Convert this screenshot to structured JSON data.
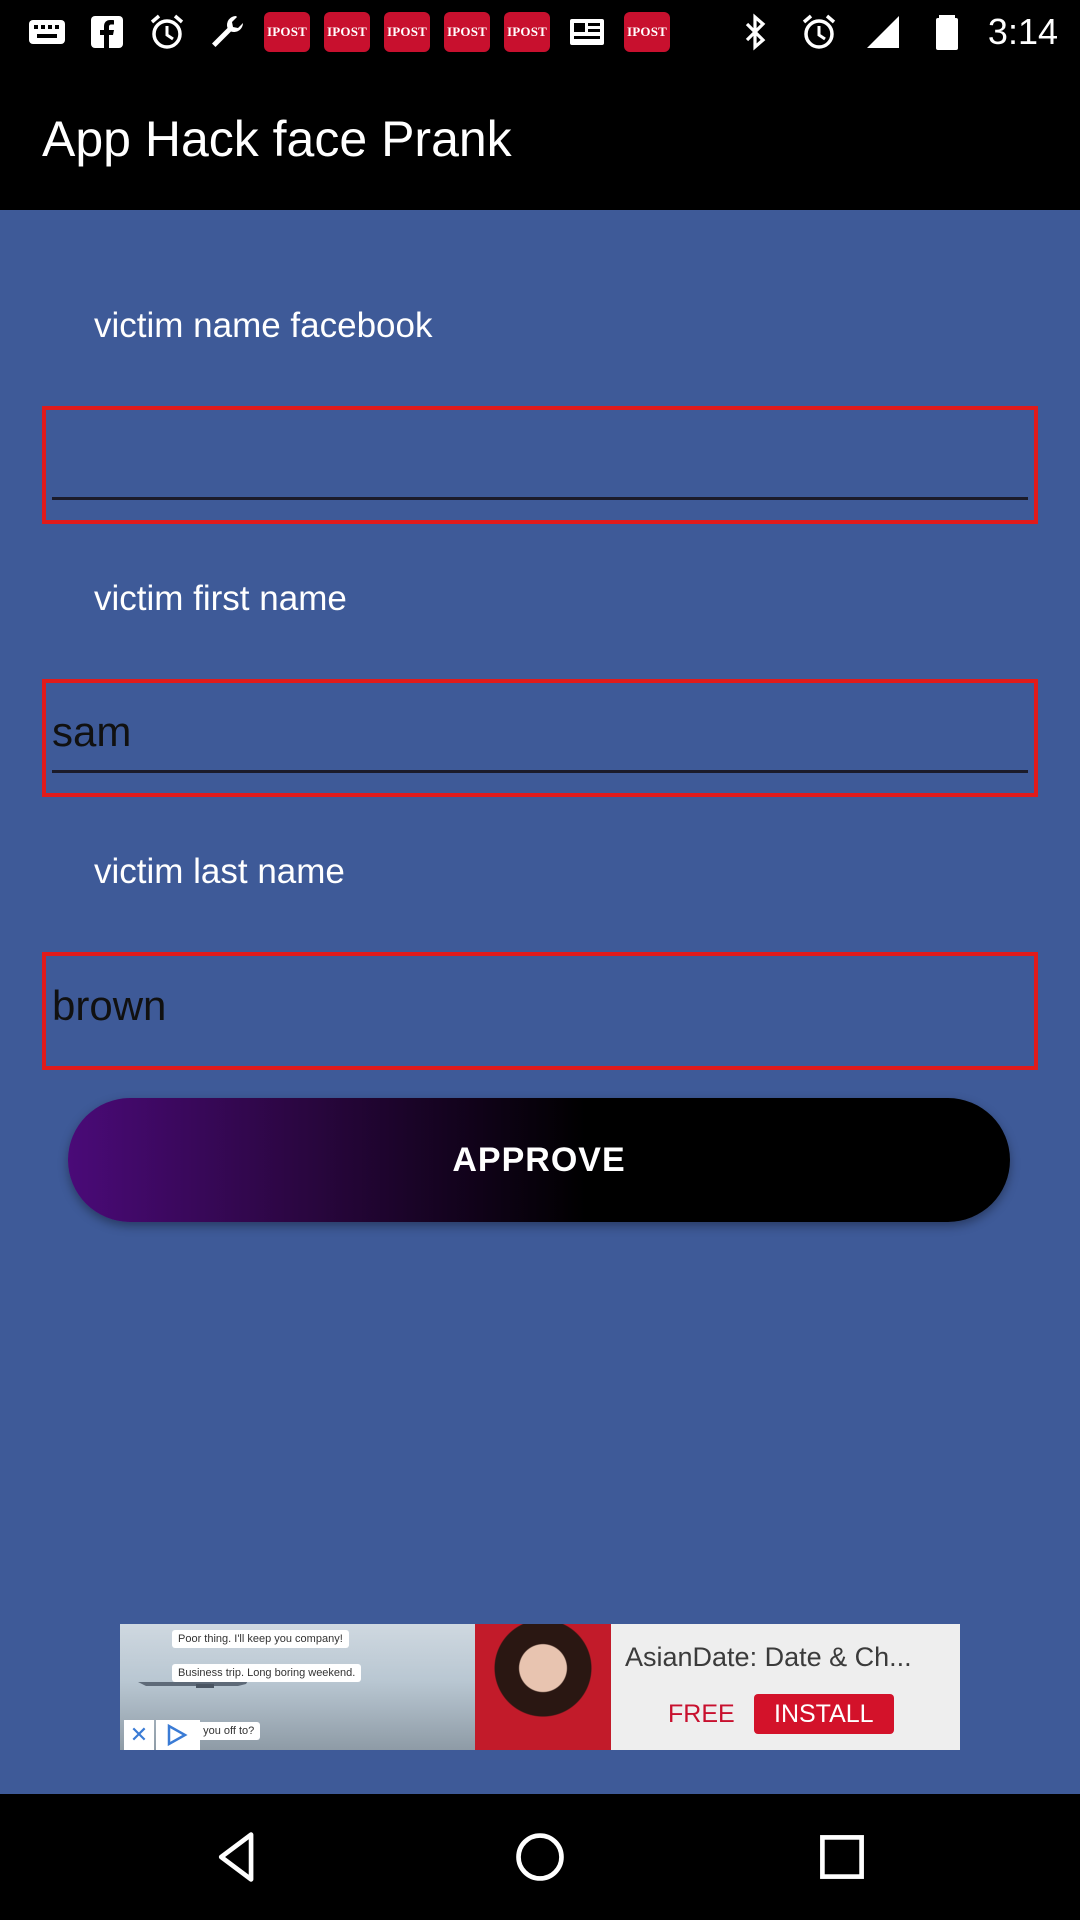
{
  "status_bar": {
    "time": "3:14",
    "notification_icons": [
      "messages-icon",
      "facebook-icon",
      "alarm-icon",
      "wrench-icon",
      "ipost-icon",
      "ipost-icon",
      "ipost-icon",
      "ipost-icon",
      "ipost-icon",
      "news-icon",
      "ipost-icon"
    ],
    "ipost_label": "IPOST"
  },
  "app_bar": {
    "title": "App Hack face Prank"
  },
  "form": {
    "facebook_name": {
      "label": "victim name facebook",
      "value": ""
    },
    "first_name": {
      "label": "victim first name",
      "value": "sam"
    },
    "last_name": {
      "label": "victim last name",
      "value": "brown"
    },
    "approve_label": "APPROVE"
  },
  "ad": {
    "title": "AsianDate: Date & Ch...",
    "free_label": "FREE",
    "install_label": "INSTALL",
    "bubbles": [
      "Poor thing. I'll keep you company!",
      "Business trip. Long boring weekend.",
      "here you off to?"
    ],
    "close_glyph": "✕"
  },
  "nav_bar": {
    "buttons": [
      "back",
      "home",
      "recents"
    ]
  },
  "colors": {
    "background": "#3e5a98",
    "field_border": "#e01b1b",
    "ipost_red": "#c8102e"
  }
}
